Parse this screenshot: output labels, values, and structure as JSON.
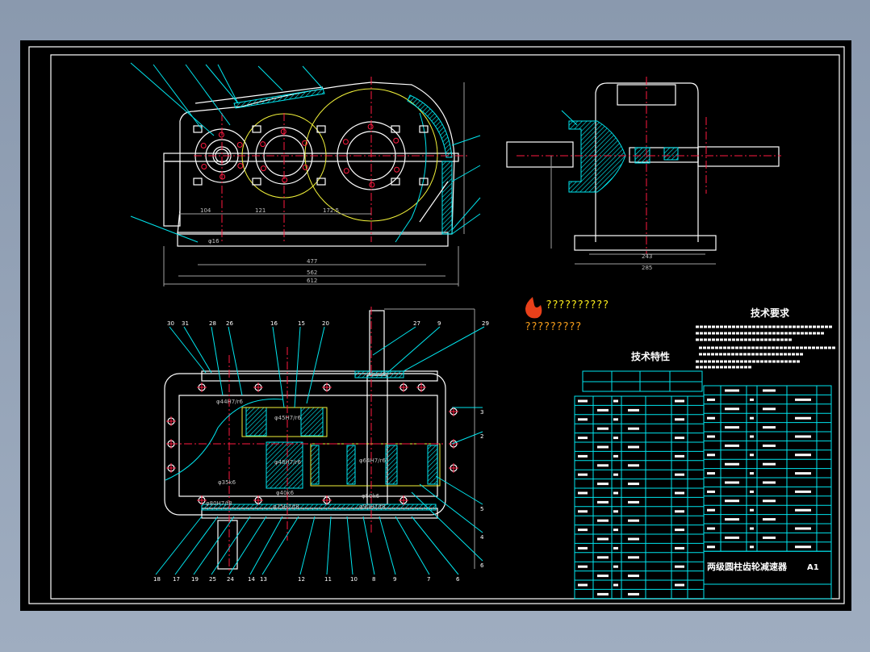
{
  "drawing": {
    "title": "两级圆柱齿轮减速器",
    "scale": "A1",
    "tech_requirements_heading": "技术要求",
    "tech_specs_heading": "技术特性",
    "logo_line1": "??????????",
    "logo_line2": "?????????"
  },
  "front_view": {
    "dims": [
      "104",
      "121",
      "172.5",
      "φ16",
      "477",
      "562",
      "612"
    ]
  },
  "side_view": {
    "dims": [
      "243",
      "285"
    ]
  },
  "plan_view": {
    "fits": [
      "φ44H7/r6",
      "φ45H7/r6",
      "φ48H7/r6",
      "φ64H7/r6",
      "φ35k6",
      "φ40k6",
      "φ50k6",
      "φ75H7/f8",
      "φ90H7/f8",
      "φ80H7/f8"
    ],
    "leaders_top": [
      "30",
      "31",
      "28",
      "26",
      "16",
      "15",
      "20",
      "27",
      "9",
      "29"
    ],
    "leaders_right": [
      "3",
      "2",
      "5",
      "4",
      "6"
    ],
    "leaders_bottom": [
      "18",
      "17",
      "19",
      "25",
      "24",
      "14",
      "13",
      "12",
      "11",
      "10",
      "8",
      "9",
      "7",
      "6"
    ]
  },
  "colors": {
    "outline": "#ffffff",
    "hatch": "#00e5ee",
    "centerline": "#ff1a40",
    "pitch_circle": "#f2f23a",
    "dimension": "#a0a0a0"
  }
}
